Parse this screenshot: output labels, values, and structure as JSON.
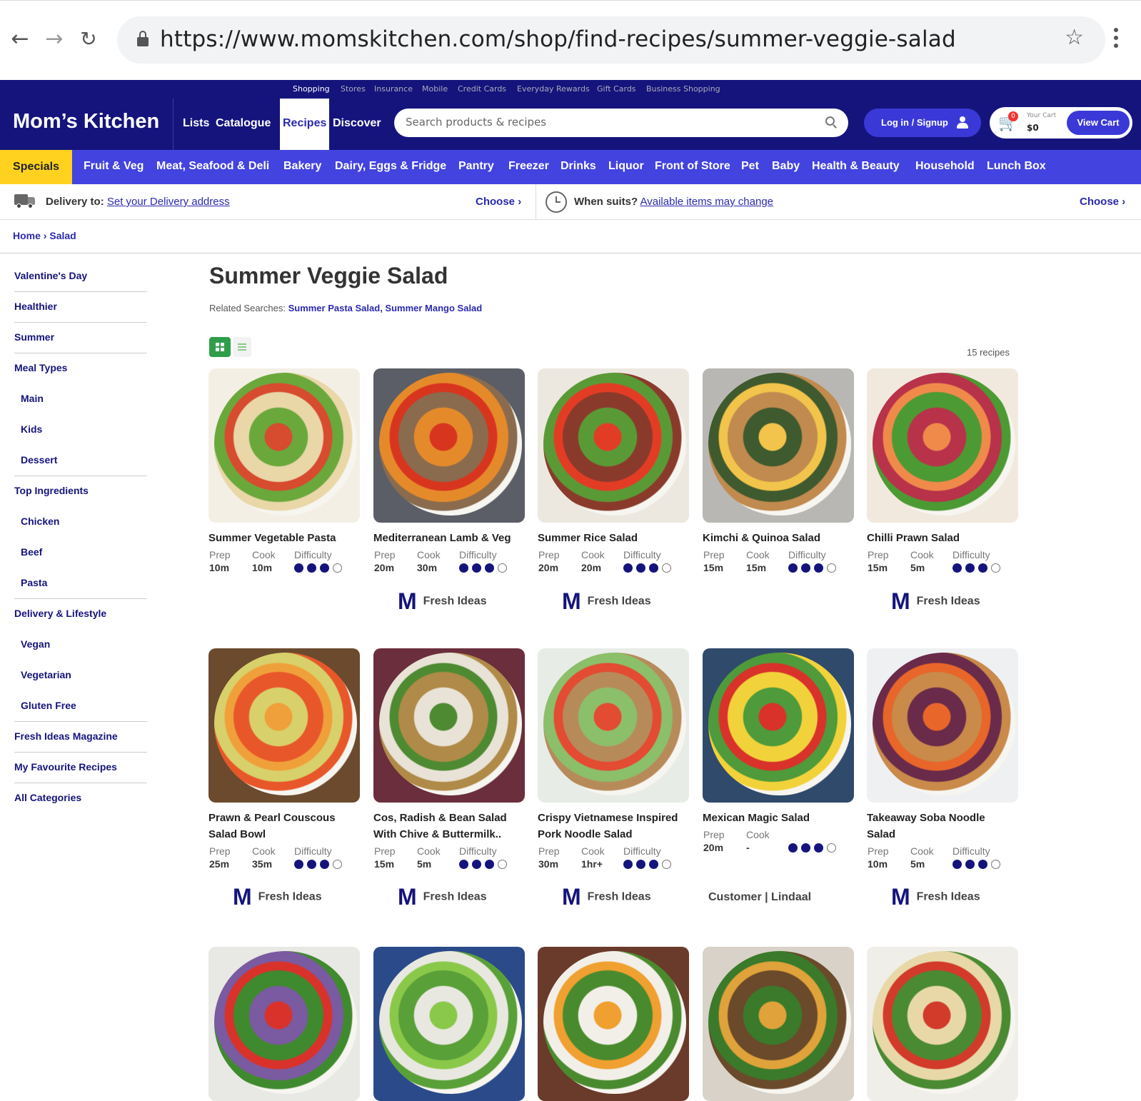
{
  "browser": {
    "url": "https://www.momskitchen.com/shop/find-recipes/summer-veggie-salad"
  },
  "utility_nav": [
    "Shopping",
    "Stores",
    "Insurance",
    "Mobile",
    "Credit Cards",
    "Everyday Rewards",
    "Gift Cards",
    "Business Shopping"
  ],
  "header": {
    "brand": "Mom’s Kitchen",
    "nav": [
      "Lists",
      "Catalogue",
      "Recipes",
      "Discover"
    ],
    "active_nav": "Recipes",
    "search_placeholder": "Search products & recipes",
    "login_label": "Log in / Signup",
    "cart_label": "Your Cart",
    "cart_amount": "$0",
    "cart_count": "0",
    "view_cart_label": "View Cart"
  },
  "categories": [
    "Specials",
    "Fruit & Veg",
    "Meat, Seafood & Deli",
    "Bakery",
    "Dairy, Eggs & Fridge",
    "Pantry",
    "Freezer",
    "Drinks",
    "Liquor",
    "Front of Store",
    "Pet",
    "Baby",
    "Health & Beauty",
    "Household",
    "Lunch Box"
  ],
  "delivery": {
    "label": "Delivery to:",
    "link": "Set your Delivery address",
    "choose": "Choose",
    "when_label": "When suits?",
    "when_link": "Available items may change",
    "choose2": "Choose"
  },
  "breadcrumb": [
    "Home",
    "Salad"
  ],
  "sidebar": [
    {
      "label": "Valentine's Day",
      "sub": false
    },
    {
      "label": "Healthier",
      "sub": false
    },
    {
      "label": "Summer",
      "sub": false
    },
    {
      "label": "Meal Types",
      "sub": false
    },
    {
      "label": "Main",
      "sub": true
    },
    {
      "label": "Kids",
      "sub": true
    },
    {
      "label": "Dessert",
      "sub": true
    },
    {
      "label": "Top Ingredients",
      "sub": false
    },
    {
      "label": "Chicken",
      "sub": true
    },
    {
      "label": "Beef",
      "sub": true
    },
    {
      "label": "Pasta",
      "sub": true
    },
    {
      "label": "Delivery & Lifestyle",
      "sub": false
    },
    {
      "label": "Vegan",
      "sub": true
    },
    {
      "label": "Vegetarian",
      "sub": true
    },
    {
      "label": "Gluten Free",
      "sub": true
    },
    {
      "label": "Fresh Ideas Magazine",
      "sub": false
    },
    {
      "label": "My Favourite Recipes",
      "sub": false
    },
    {
      "label": "All Categories",
      "sub": false
    }
  ],
  "main": {
    "title": "Summer Veggie Salad",
    "related_label": "Related Searches:",
    "related_links": "Summer Pasta Salad, Summer Mango Salad",
    "count": "15 recipes",
    "labels": {
      "prep": "Prep",
      "cook": "Cook",
      "difficulty": "Difficulty"
    }
  },
  "recipes": [
    {
      "name": "Summer Vegetable Pasta",
      "prep": "10m",
      "cook": "10m",
      "difficulty": 3,
      "source": "",
      "colors": [
        "#f4efe4",
        "#e9d7a8",
        "#d74b2f",
        "#6aa83b"
      ]
    },
    {
      "name": "Mediterranean Lamb & Veg",
      "prep": "20m",
      "cook": "30m",
      "difficulty": 3,
      "source": "Fresh Ideas",
      "colors": [
        "#5b5e66",
        "#8a6b4e",
        "#d8351f",
        "#e58a2a"
      ]
    },
    {
      "name": "Summer Rice Salad",
      "prep": "20m",
      "cook": "20m",
      "difficulty": 3,
      "source": "Fresh Ideas",
      "colors": [
        "#ece8e0",
        "#8a3a2b",
        "#e33c25",
        "#5a9a36"
      ]
    },
    {
      "name": "Kimchi & Quinoa Salad",
      "prep": "15m",
      "cook": "15m",
      "difficulty": 3,
      "source": "",
      "colors": [
        "#b9b7b3",
        "#c18a4e",
        "#f2c44b",
        "#3f5a2e"
      ]
    },
    {
      "name": "Chilli Prawn Salad",
      "prep": "15m",
      "cook": "5m",
      "difficulty": 3,
      "source": "Fresh Ideas",
      "colors": [
        "#f2e9de",
        "#4c9a33",
        "#f08a4b",
        "#b8324a"
      ]
    },
    {
      "name": "Prawn & Pearl Couscous\nSalad Bowl",
      "prep": "25m",
      "cook": "35m",
      "difficulty": 3,
      "source": "Fresh Ideas",
      "colors": [
        "#6b4a2e",
        "#e8572a",
        "#f0a03a",
        "#d8d06a"
      ]
    },
    {
      "name": "Cos, Radish & Bean Salad\nWith Chive & Buttermilk..",
      "prep": "15m",
      "cook": "5m",
      "difficulty": 3,
      "source": "Fresh Ideas",
      "colors": [
        "#6a2e3c",
        "#b08a48",
        "#4e8a32",
        "#e9e2d6"
      ]
    },
    {
      "name": "Crispy Vietnamese Inspired\nPork Noodle Salad",
      "prep": "30m",
      "cook": "1hr+",
      "difficulty": 3,
      "source": "Fresh Ideas",
      "colors": [
        "#e8ece6",
        "#b78a5a",
        "#e34b32",
        "#8cbf6a"
      ]
    },
    {
      "name": "Mexican Magic Salad",
      "prep": "20m",
      "cook": "-",
      "difficulty": 3,
      "source": "Customer | Lindaal",
      "colors": [
        "#2f4a6a",
        "#f2d23a",
        "#d8322a",
        "#4f9a3a"
      ]
    },
    {
      "name": "Takeaway Soba Noodle\nSalad",
      "prep": "10m",
      "cook": "5m",
      "difficulty": 3,
      "source": "Fresh Ideas",
      "colors": [
        "#eef0f2",
        "#c98a4a",
        "#e8662a",
        "#6a2a4a"
      ]
    },
    {
      "name": "",
      "prep": "",
      "cook": "",
      "difficulty": 0,
      "source": "",
      "colors": [
        "#e8e8e4",
        "#3f8a2e",
        "#d8322a",
        "#7a5aa0"
      ]
    },
    {
      "name": "",
      "prep": "",
      "cook": "",
      "difficulty": 0,
      "source": "",
      "colors": [
        "#2a4a8a",
        "#5aa038",
        "#8ac84a",
        "#e8e8e0"
      ]
    },
    {
      "name": "",
      "prep": "",
      "cook": "",
      "difficulty": 0,
      "source": "",
      "colors": [
        "#6a3a2a",
        "#4a8a2e",
        "#f0a030",
        "#f2efe8"
      ]
    },
    {
      "name": "",
      "prep": "",
      "cook": "",
      "difficulty": 0,
      "source": "",
      "colors": [
        "#d8d2c8",
        "#6a4a2a",
        "#e0a23a",
        "#3a7a2a"
      ]
    },
    {
      "name": "",
      "prep": "",
      "cook": "",
      "difficulty": 0,
      "source": "",
      "colors": [
        "#f0eee8",
        "#4a8a32",
        "#d23a2a",
        "#e8d8a8"
      ]
    }
  ]
}
